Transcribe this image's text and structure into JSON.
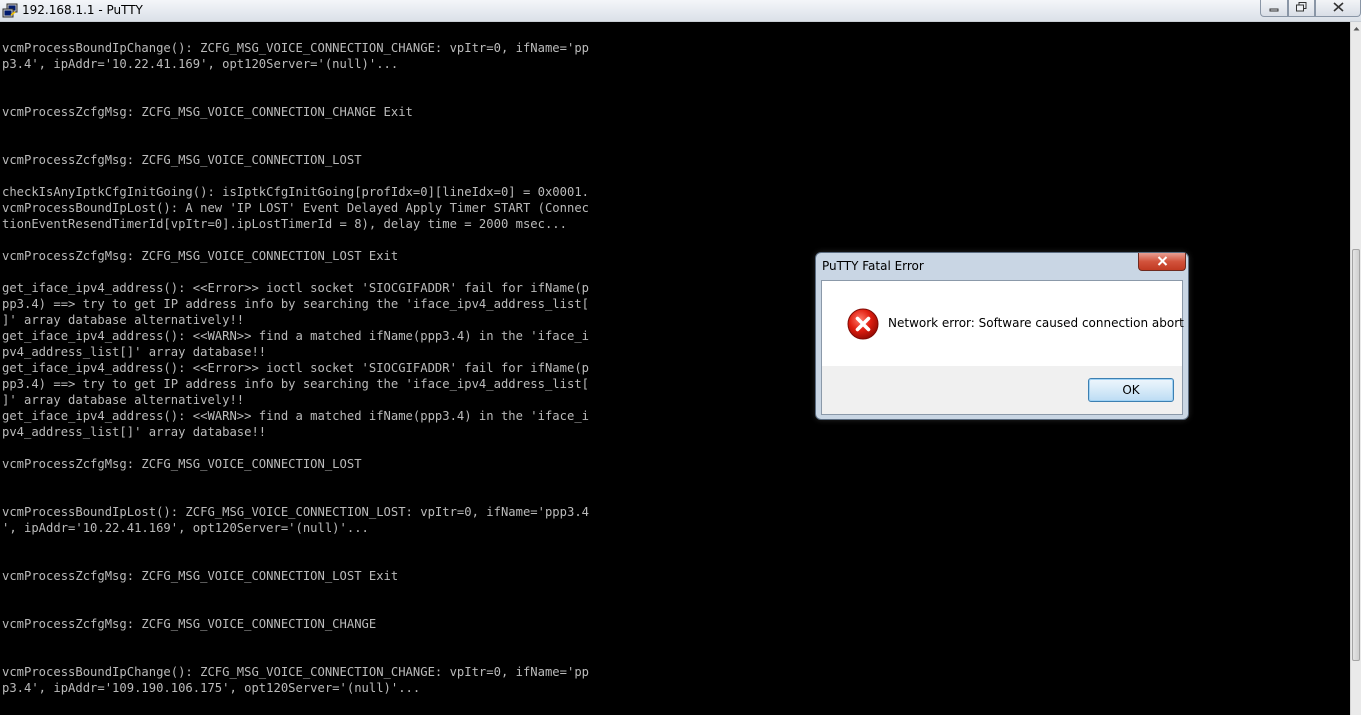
{
  "window": {
    "title": "192.168.1.1 - PuTTY"
  },
  "icons": {
    "app": "putty-icon",
    "minimize": "minimize-icon",
    "maximize": "maximize-icon",
    "close": "close-icon",
    "error": "error-icon"
  },
  "terminal": {
    "text_color": "#bbbbbb",
    "background": "#000000",
    "lines": [
      "vcmProcessBoundIpChange(): ZCFG_MSG_VOICE_CONNECTION_CHANGE: vpItr=0, ifName='pp",
      "p3.4', ipAddr='10.22.41.169', opt120Server='(null)'...",
      "",
      "",
      "vcmProcessZcfgMsg: ZCFG_MSG_VOICE_CONNECTION_CHANGE Exit",
      "",
      "",
      "vcmProcessZcfgMsg: ZCFG_MSG_VOICE_CONNECTION_LOST",
      "",
      "checkIsAnyIptkCfgInitGoing(): isIptkCfgInitGoing[profIdx=0][lineIdx=0] = 0x0001.",
      "vcmProcessBoundIpLost(): A new 'IP LOST' Event Delayed Apply Timer START (Connec",
      "tionEventResendTimerId[vpItr=0].ipLostTimerId = 8), delay time = 2000 msec...",
      "",
      "vcmProcessZcfgMsg: ZCFG_MSG_VOICE_CONNECTION_LOST Exit",
      "",
      "get_iface_ipv4_address(): <<Error>> ioctl socket 'SIOCGIFADDR' fail for ifName(p",
      "pp3.4) ==> try to get IP address info by searching the 'iface_ipv4_address_list[",
      "]' array database alternatively!!",
      "get_iface_ipv4_address(): <<WARN>> find a matched ifName(ppp3.4) in the 'iface_i",
      "pv4_address_list[]' array database!!",
      "get_iface_ipv4_address(): <<Error>> ioctl socket 'SIOCGIFADDR' fail for ifName(p",
      "pp3.4) ==> try to get IP address info by searching the 'iface_ipv4_address_list[",
      "]' array database alternatively!!",
      "get_iface_ipv4_address(): <<WARN>> find a matched ifName(ppp3.4) in the 'iface_i",
      "pv4_address_list[]' array database!!",
      "",
      "vcmProcessZcfgMsg: ZCFG_MSG_VOICE_CONNECTION_LOST",
      "",
      "",
      "vcmProcessBoundIpLost(): ZCFG_MSG_VOICE_CONNECTION_LOST: vpItr=0, ifName='ppp3.4",
      "', ipAddr='10.22.41.169', opt120Server='(null)'...",
      "",
      "",
      "vcmProcessZcfgMsg: ZCFG_MSG_VOICE_CONNECTION_LOST Exit",
      "",
      "",
      "vcmProcessZcfgMsg: ZCFG_MSG_VOICE_CONNECTION_CHANGE",
      "",
      "",
      "vcmProcessBoundIpChange(): ZCFG_MSG_VOICE_CONNECTION_CHANGE: vpItr=0, ifName='pp",
      "p3.4', ipAddr='109.190.106.175', opt120Server='(null)'..."
    ]
  },
  "dialog": {
    "title": "PuTTY Fatal Error",
    "message": "Network error: Software caused connection abort",
    "ok_label": "OK",
    "close_color": "#c13a22"
  }
}
